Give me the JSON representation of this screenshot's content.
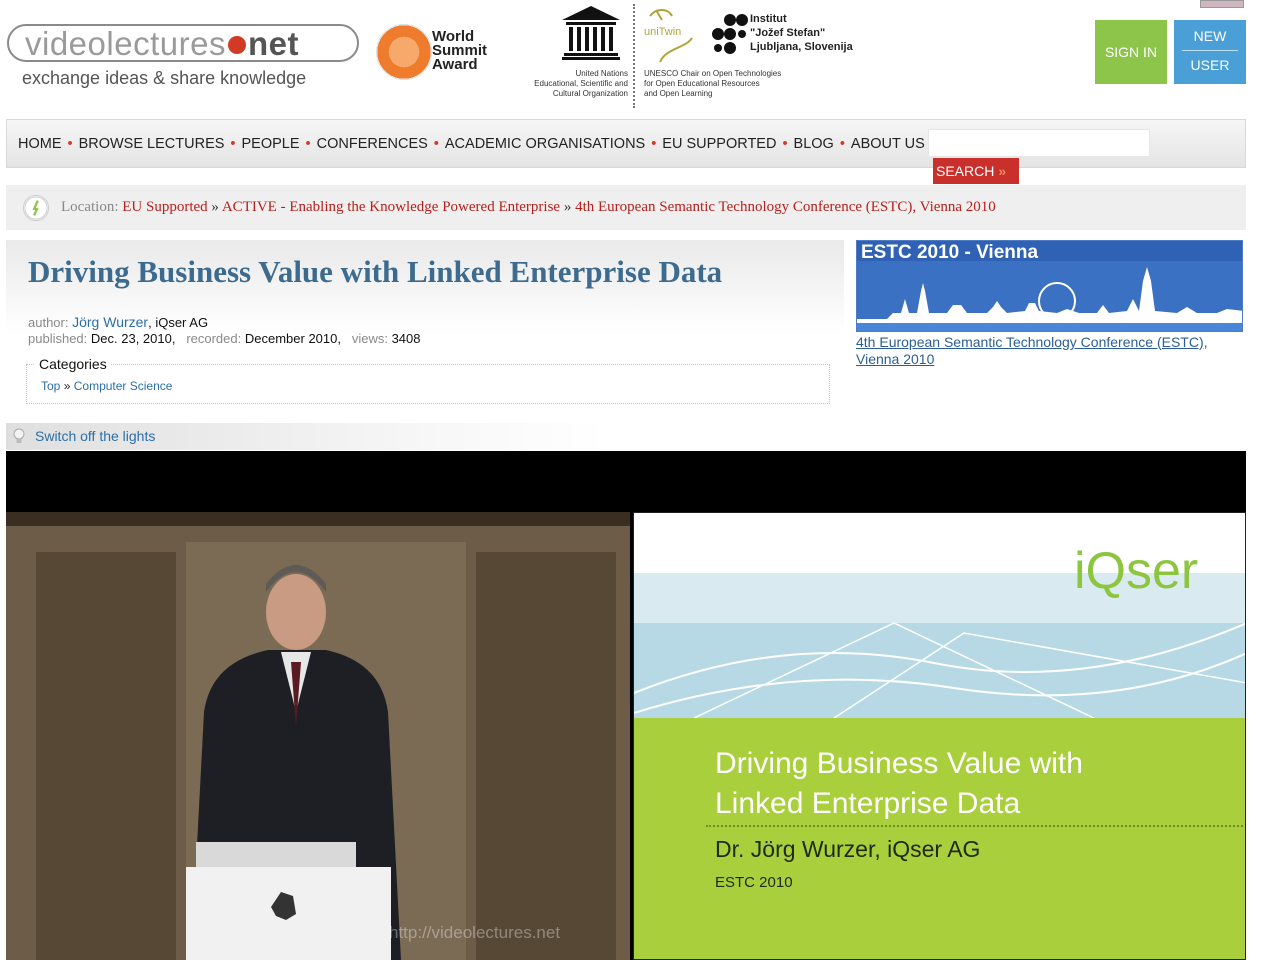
{
  "header": {
    "logo": {
      "part1": "videolectures",
      "part2": "net"
    },
    "tagline": "exchange ideas & share knowledge",
    "wsa": {
      "line1": "World",
      "line2": "Summit",
      "line3": "Award"
    },
    "unesco": {
      "line1": "United Nations",
      "line2": "Educational, Scientific and",
      "line3": "Cultural Organization"
    },
    "unitwin": {
      "label": "uniTwin",
      "caption1": "UNESCO Chair on Open Technologies",
      "caption2": "for Open Educational Resources",
      "caption3": "and Open Learning"
    },
    "ijs": {
      "line1": "Institut",
      "line2": "\"Jožef Stefan\"",
      "line3": "Ljubljana, Slovenija"
    },
    "sign_in": "SIGN IN",
    "new_user_1": "NEW",
    "new_user_2": "USER"
  },
  "nav": {
    "items": [
      "HOME",
      "BROWSE LECTURES",
      "PEOPLE",
      "CONFERENCES",
      "ACADEMIC ORGANISATIONS",
      "EU SUPPORTED",
      "BLOG",
      "ABOUT US"
    ],
    "separator": "•",
    "search_value": "",
    "search_button": "SEARCH",
    "search_chevron": "»"
  },
  "breadcrumb": {
    "label": "Location:",
    "items": [
      "EU Supported",
      "ACTIVE - Enabling the Knowledge Powered Enterprise",
      "4th European Semantic Technology Conference (ESTC), Vienna 2010"
    ],
    "separator": "»"
  },
  "lecture": {
    "title": "Driving Business Value with Linked Enterprise Data",
    "author_label": "author:",
    "author": "Jörg Wurzer",
    "affiliation": ", iQser AG",
    "published_label": "published:",
    "published": "Dec. 23, 2010,",
    "recorded_label": "recorded:",
    "recorded": "December 2010,",
    "views_label": "views:",
    "views": "3408",
    "categories_label": "Categories",
    "categories": [
      "Top",
      "Computer Science"
    ],
    "category_separator": "»"
  },
  "event": {
    "banner_title": "ESTC 2010 - Vienna",
    "link": "4th European Semantic Technology Conference (ESTC), Vienna 2010"
  },
  "lights": {
    "label": "Switch off the lights"
  },
  "player": {
    "watermark": "http://videolectures.net",
    "slide": {
      "brand": "iQser",
      "title_line1": "Driving Business Value with",
      "title_line2": "Linked Enterprise Data",
      "author": "Dr. Jörg Wurzer, iQser AG",
      "event": "ESTC 2010"
    }
  },
  "colors": {
    "accent_red": "#d13b26",
    "link_blue": "#2b6fa8",
    "signin_green": "#8dc44a",
    "newuser_blue": "#4a9fd7",
    "slide_green": "#a9cf3c",
    "banner_blue": "#2f62b4"
  }
}
